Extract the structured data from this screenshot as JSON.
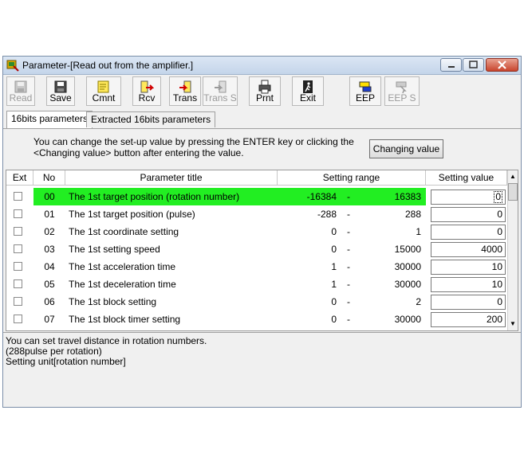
{
  "window": {
    "title": "Parameter-[Read out from the amplifier.]"
  },
  "toolbar": {
    "buttons": [
      {
        "label": "Read",
        "icon": "floppy-disk-icon",
        "enabled": false
      },
      {
        "label": "Save",
        "icon": "floppy-disk-icon",
        "enabled": true
      },
      {
        "label": "Cmnt",
        "icon": "note-icon",
        "enabled": true
      },
      {
        "label": "Rcv",
        "icon": "receive-icon",
        "enabled": true
      },
      {
        "label": "Trans",
        "icon": "transfer-icon",
        "enabled": true
      },
      {
        "label": "Trans S",
        "icon": "transfer-select-icon",
        "enabled": false
      },
      {
        "label": "Prnt",
        "icon": "printer-icon",
        "enabled": true
      },
      {
        "label": "Exit",
        "icon": "exit-icon",
        "enabled": true
      },
      {
        "label": "EEP",
        "icon": "eeprom-icon",
        "enabled": true
      },
      {
        "label": "EEP S",
        "icon": "eeprom-select-icon",
        "enabled": false
      }
    ]
  },
  "tabs": [
    {
      "label": "16bits parameters",
      "active": true
    },
    {
      "label": "Extracted 16bits parameters",
      "active": false
    }
  ],
  "info": {
    "line1": "You can change the set-up value by pressing the ENTER key or clicking the",
    "line2": "<Changing value> button after entering the value.",
    "changing_value_button": "Changing value"
  },
  "table": {
    "headers": {
      "ext": "Ext",
      "no": "No",
      "title": "Parameter title",
      "range": "Setting range",
      "value": "Setting value"
    },
    "rows": [
      {
        "no": "00",
        "title": "The 1st target position (rotation number)",
        "min": "-16384",
        "dash": "-",
        "max": "16383",
        "value": "0",
        "selected": true
      },
      {
        "no": "01",
        "title": "The 1st target position (pulse)",
        "min": "-288",
        "dash": "-",
        "max": "288",
        "value": "0",
        "selected": false
      },
      {
        "no": "02",
        "title": "The 1st coordinate setting",
        "min": "0",
        "dash": "-",
        "max": "1",
        "value": "0",
        "selected": false
      },
      {
        "no": "03",
        "title": "The 1st setting speed",
        "min": "0",
        "dash": "-",
        "max": "15000",
        "value": "4000",
        "selected": false
      },
      {
        "no": "04",
        "title": "The 1st acceleration time",
        "min": "1",
        "dash": "-",
        "max": "30000",
        "value": "10",
        "selected": false
      },
      {
        "no": "05",
        "title": "The 1st deceleration time",
        "min": "1",
        "dash": "-",
        "max": "30000",
        "value": "10",
        "selected": false
      },
      {
        "no": "06",
        "title": "The 1st block setting",
        "min": "0",
        "dash": "-",
        "max": "2",
        "value": "0",
        "selected": false
      },
      {
        "no": "07",
        "title": "The 1st block timer setting",
        "min": "0",
        "dash": "-",
        "max": "30000",
        "value": "200",
        "selected": false
      }
    ]
  },
  "description": {
    "line1": "You can set travel distance in rotation numbers.",
    "line2": "(288pulse per rotation)",
    "line3": "Setting unit[rotation number]"
  },
  "colors": {
    "selected_row": "#22ee22"
  }
}
